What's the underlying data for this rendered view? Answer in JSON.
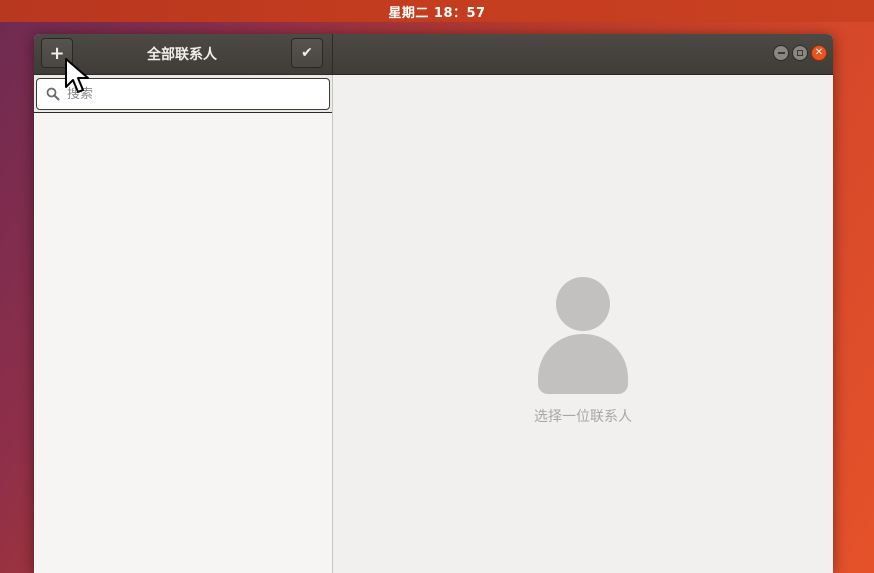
{
  "top_bar": {
    "clock": "星期二 18：57"
  },
  "window": {
    "header": {
      "title": "全部联系人",
      "add_button_icon": "plus-icon",
      "select_button_icon": "checkmark-icon"
    },
    "controls": {
      "minimize_icon": "minimize-icon",
      "maximize_icon": "maximize-icon",
      "close_icon": "close-icon",
      "close_color": "#e95420"
    },
    "search": {
      "placeholder": "搜索",
      "value": ""
    },
    "detail": {
      "empty_state_icon": "person-silhouette-icon",
      "empty_state_text": "选择一位联系人"
    }
  },
  "colors": {
    "accent": "#e95420",
    "headerbar": "#45423e"
  }
}
